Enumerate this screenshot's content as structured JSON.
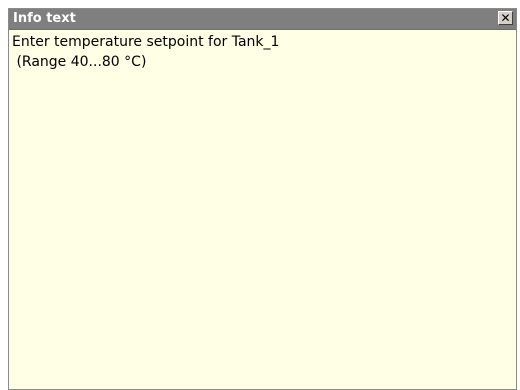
{
  "window": {
    "title": "Info text",
    "close_icon": "close-icon",
    "close_glyph": "✕"
  },
  "content": {
    "lines": [
      "Enter temperature setpoint for Tank_1",
      " (Range 40...80 °C)"
    ]
  },
  "colors": {
    "titlebar": "#7f7f7f",
    "background": "#ffffe6"
  }
}
